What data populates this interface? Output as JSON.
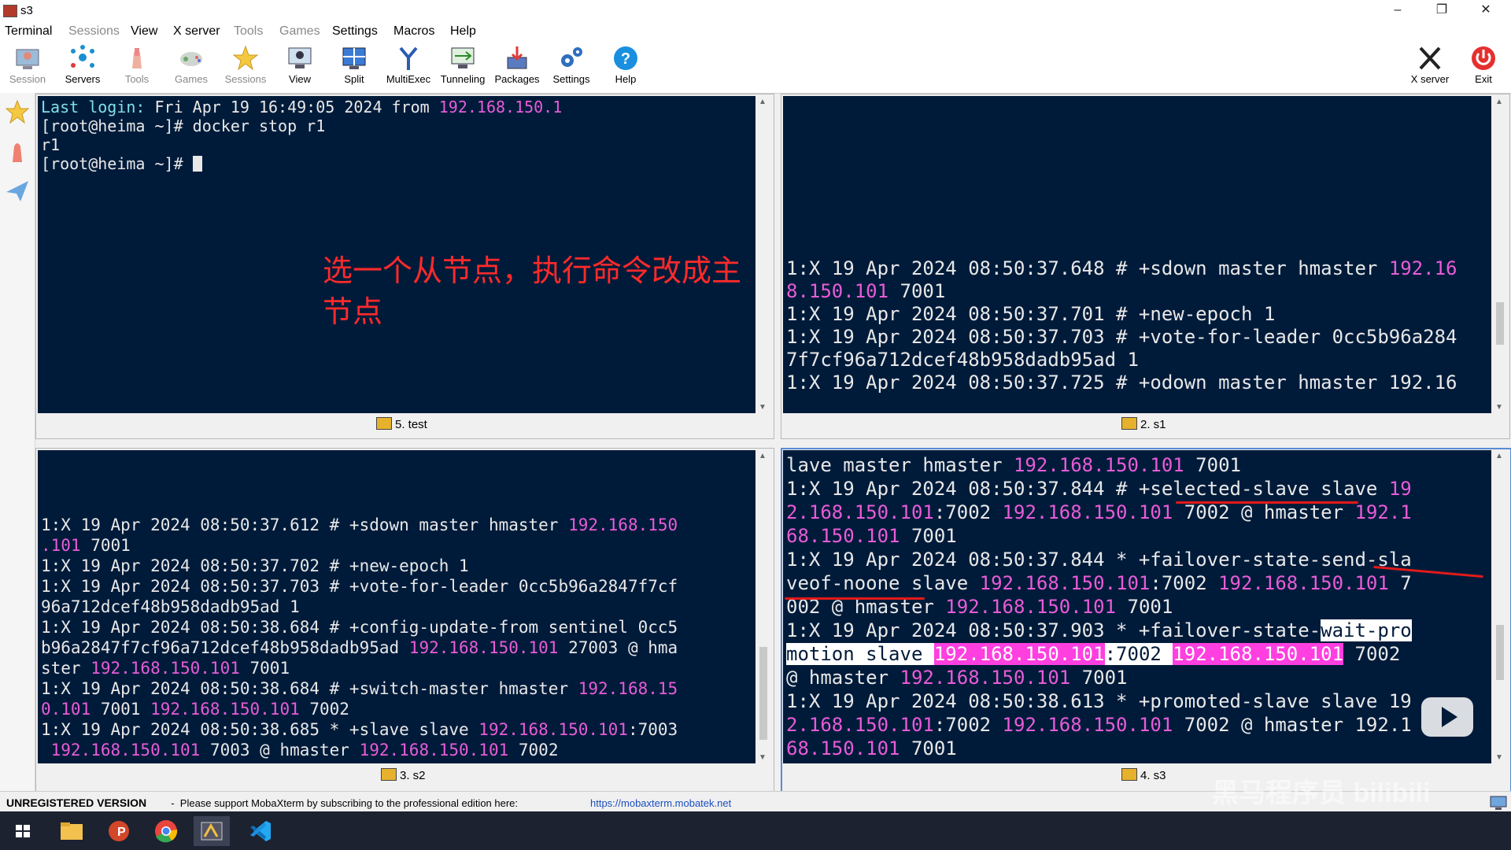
{
  "window": {
    "title": "s3"
  },
  "menu": [
    "Terminal",
    "Sessions",
    "View",
    "X server",
    "Tools",
    "Games",
    "Settings",
    "Macros",
    "Help"
  ],
  "toolbar": {
    "session": "Session",
    "servers": "Servers",
    "tools": "Tools",
    "games": "Games",
    "sessions": "Sessions",
    "view": "View",
    "split": "Split",
    "multiexec": "MultiExec",
    "tunneling": "Tunneling",
    "packages": "Packages",
    "settings": "Settings",
    "help": "Help",
    "xserver": "X server",
    "exit": "Exit"
  },
  "panes": {
    "test": {
      "label": "5. test",
      "l1_a": "Last login: ",
      "l1_b": "Fri Apr 19 16:49:05 2024 from ",
      "l1_ip": "192.168.150.1",
      "l2": "[root@heima ~]# docker stop r1",
      "l3": "r1",
      "l4": "[root@heima ~]# "
    },
    "s1": {
      "label": "2. s1",
      "l1_a": "1:X 19 Apr 2024 08:50:37.648 # +sdown master hmaster ",
      "l1_ip": "192.16",
      "l2_ip": "8.150.101",
      "l2_b": " 7001",
      "l3": "1:X 19 Apr 2024 08:50:37.701 # +new-epoch 1",
      "l4": "1:X 19 Apr 2024 08:50:37.703 # +vote-for-leader 0cc5b96a284",
      "l5": "7f7cf96a712dcef48b958dadb95ad 1",
      "l6": "1:X 19 Apr 2024 08:50:37.725 # +odown master hmaster 192.16"
    },
    "s2": {
      "label": "3. s2",
      "l1_a": "1:X 19 Apr 2024 08:50:37.612 # +sdown master hmaster ",
      "l1_ip": "192.168.150",
      "l2_ip": ".101",
      "l2_b": " 7001",
      "l3": "1:X 19 Apr 2024 08:50:37.702 # +new-epoch 1",
      "l4": "1:X 19 Apr 2024 08:50:37.703 # +vote-for-leader 0cc5b96a2847f7cf",
      "l5": "96a712dcef48b958dadb95ad 1",
      "l6": "1:X 19 Apr 2024 08:50:38.684 # +config-update-from sentinel 0cc5",
      "l7_a": "b96a2847f7cf96a712dcef48b958dadb95ad ",
      "l7_ip": "192.168.150.101",
      "l7_b": " 27003 @ hma",
      "l8_a": "ster ",
      "l8_ip": "192.168.150.101",
      "l8_b": " 7001",
      "l9_a": "1:X 19 Apr 2024 08:50:38.684 # +switch-master hmaster ",
      "l9_ip": "192.168.15",
      "l10_ip": "0.101",
      "l10_b": " 7001 ",
      "l10_ip2": "192.168.150.101",
      "l10_c": " 7002",
      "l11_a": "1:X 19 Apr 2024 08:50:38.685 * +slave slave ",
      "l11_ip": "192.168.150.101",
      "l11_b": ":7003",
      "l12_ip": " 192.168.150.101",
      "l12_b": " 7003 @ hmaster ",
      "l12_ip2": "192.168.150.101",
      "l12_c": " 7002"
    },
    "s3": {
      "label": "4. s3",
      "l1_a": "lave master hmaster ",
      "l1_ip": "192.168.150.101",
      "l1_b": " 7001",
      "l2_a": "1:X 19 Apr 2024 08:50:37.844 # +selected-slave slave ",
      "l2_ip": "19",
      "l3_ip": "2.168.150.101",
      "l3_b": ":7002 ",
      "l3_ip2": "192.168.150.101",
      "l3_c": " 7002 @ hmaster ",
      "l3_ip3": "192.1",
      "l4_ip": "68.150.101",
      "l4_b": " 7001",
      "l5": "1:X 19 Apr 2024 08:50:37.844 * +failover-state-send-sla",
      "l6_a": "veof-noone slave ",
      "l6_ip": "192.168.150.101",
      "l6_b": ":7002 ",
      "l6_ip2": "192.168.150.101",
      "l6_c": " 7",
      "l7_a": "002 @ hmaster ",
      "l7_ip": "192.168.150.101",
      "l7_b": " 7001",
      "l8_a": "1:X 19 Apr 2024 08:50:37.903 * +failover-state-",
      "l8_hl": "wait-pro",
      "l9_hl": "motion slave ",
      "l9_ip": "192.168.150.101",
      "l9_b": ":7002 ",
      "l9_ip2": "192.168.150.101",
      "l9_c": " 7002",
      "l10_a": "@ hmaster ",
      "l10_ip": "192.168.150.101",
      "l10_b": " 7001",
      "l11": "1:X 19 Apr 2024 08:50:38.613 * +promoted-slave slave 19",
      "l12_ip": "2.168.150.101",
      "l12_b": ":7002 ",
      "l12_ip2": "192.168.150.101",
      "l12_c": " 7002 @ hmaster 192.1",
      "l13_ip": "68.150.101",
      "l13_b": " 7001"
    }
  },
  "annotation": "选一个从节点，执行命令改成主节点",
  "status": {
    "unregistered": "UNREGISTERED VERSION",
    "message": "  -  Please support MobaXterm by subscribing to the professional edition here:",
    "link": "https://mobaxterm.mobatek.net"
  },
  "watermark": "黑马程序员 bilibili",
  "colors": {
    "terminal_bg": "#001b3a",
    "ip_color": "#e85cd8",
    "annotation": "#ff2a2a",
    "underline": "#e21a1a"
  }
}
